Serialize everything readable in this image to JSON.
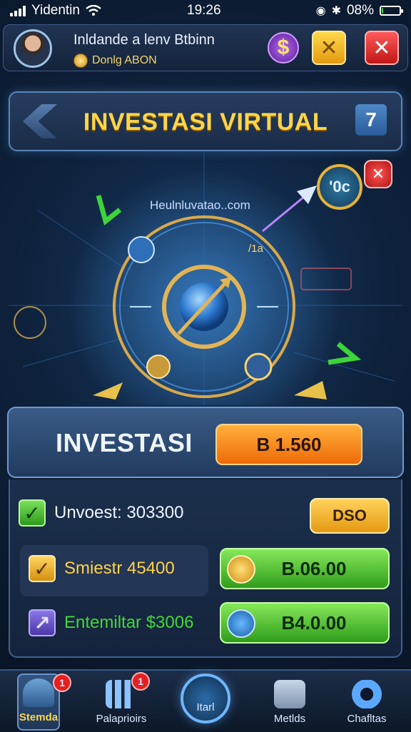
{
  "status": {
    "carrier": "Yidentin",
    "time": "19:26",
    "battery_percent": "08%",
    "battery_level": 0.08
  },
  "profile": {
    "name": "Inldande a lenv Btbinn",
    "coins": "Donlg ABON"
  },
  "title": "INVESTASI VIRTUAL",
  "hero": {
    "website": "Heulnluvatao..com",
    "badge": "'0c",
    "coord_label": "/1a",
    "share_glyph": "7"
  },
  "invest": {
    "label": "INVESTASI",
    "value": "B 1.560"
  },
  "stats": {
    "row1": {
      "text": "Unvoest: 303300",
      "button": "DSO"
    },
    "row2": {
      "text": "Smiestr 45400",
      "button": "B.06.00"
    },
    "row3": {
      "text": "Entemiltar $3006",
      "button": "B4.0.00"
    }
  },
  "nav": {
    "items": [
      {
        "label": "Stemda",
        "badge": "1"
      },
      {
        "label": "Palaprioirs",
        "badge": "1"
      },
      {
        "label": "Itarl"
      },
      {
        "label": "Metlds"
      },
      {
        "label": "Chafltas"
      }
    ]
  },
  "colors": {
    "accent_gold": "#ffd54a",
    "stat_green": "#43d63a",
    "stat_gold": "#ffd24a",
    "invest_orange": "#f07a10"
  }
}
